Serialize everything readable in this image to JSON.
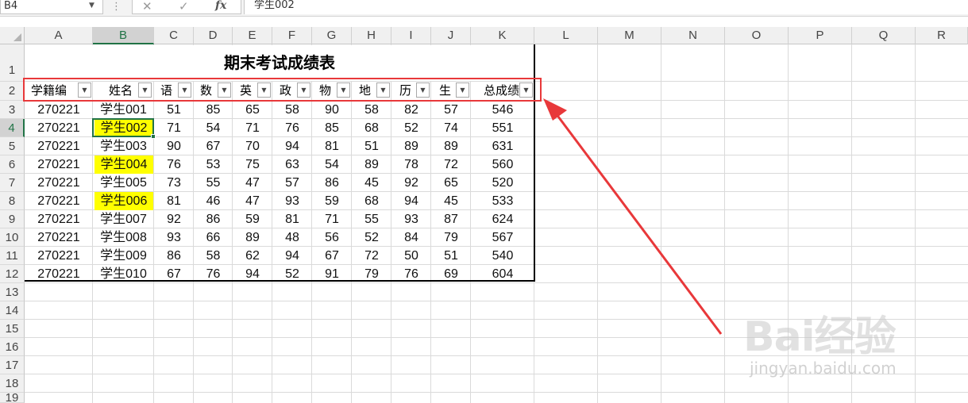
{
  "formula_bar": {
    "name_box": "B4",
    "cancel_glyph": "✕",
    "enter_glyph": "✓",
    "fx_label": "fx",
    "formula": "学生002"
  },
  "columns": [
    "A",
    "B",
    "C",
    "D",
    "E",
    "F",
    "G",
    "H",
    "I",
    "J",
    "K",
    "L",
    "M",
    "N",
    "O",
    "P",
    "Q",
    "R"
  ],
  "rows": [
    "1",
    "2",
    "3",
    "4",
    "5",
    "6",
    "7",
    "8",
    "9",
    "10",
    "11",
    "12",
    "13",
    "14",
    "15",
    "16",
    "17",
    "18",
    "19"
  ],
  "sheet": {
    "title": "期末考试成绩表",
    "headers": [
      "学籍编",
      "姓名",
      "语",
      "数",
      "英",
      "政",
      "物",
      "地",
      "历",
      "生",
      "总成绩"
    ],
    "rows": [
      [
        "270221",
        "学生001",
        "51",
        "85",
        "65",
        "58",
        "90",
        "58",
        "82",
        "57",
        "546"
      ],
      [
        "270221",
        "学生002",
        "71",
        "54",
        "71",
        "76",
        "85",
        "68",
        "52",
        "74",
        "551"
      ],
      [
        "270221",
        "学生003",
        "90",
        "67",
        "70",
        "94",
        "81",
        "51",
        "89",
        "89",
        "631"
      ],
      [
        "270221",
        "学生004",
        "76",
        "53",
        "75",
        "63",
        "54",
        "89",
        "78",
        "72",
        "560"
      ],
      [
        "270221",
        "学生005",
        "73",
        "55",
        "47",
        "57",
        "86",
        "45",
        "92",
        "65",
        "520"
      ],
      [
        "270221",
        "学生006",
        "81",
        "46",
        "47",
        "93",
        "59",
        "68",
        "94",
        "45",
        "533"
      ],
      [
        "270221",
        "学生007",
        "92",
        "86",
        "59",
        "81",
        "71",
        "55",
        "93",
        "87",
        "624"
      ],
      [
        "270221",
        "学生008",
        "93",
        "66",
        "89",
        "48",
        "56",
        "52",
        "84",
        "79",
        "567"
      ],
      [
        "270221",
        "学生009",
        "86",
        "58",
        "62",
        "94",
        "67",
        "72",
        "50",
        "51",
        "540"
      ],
      [
        "270221",
        "学生010",
        "67",
        "76",
        "94",
        "52",
        "91",
        "79",
        "76",
        "69",
        "604"
      ]
    ],
    "highlighted_names": [
      "学生002",
      "学生004",
      "学生006"
    ],
    "highlight_color": "#ffff00"
  },
  "watermark": {
    "brand": "Bai经验",
    "url": "jingyan.baidu.com"
  },
  "colors": {
    "annotation_red": "#e8383a",
    "selection_green": "#217346"
  }
}
